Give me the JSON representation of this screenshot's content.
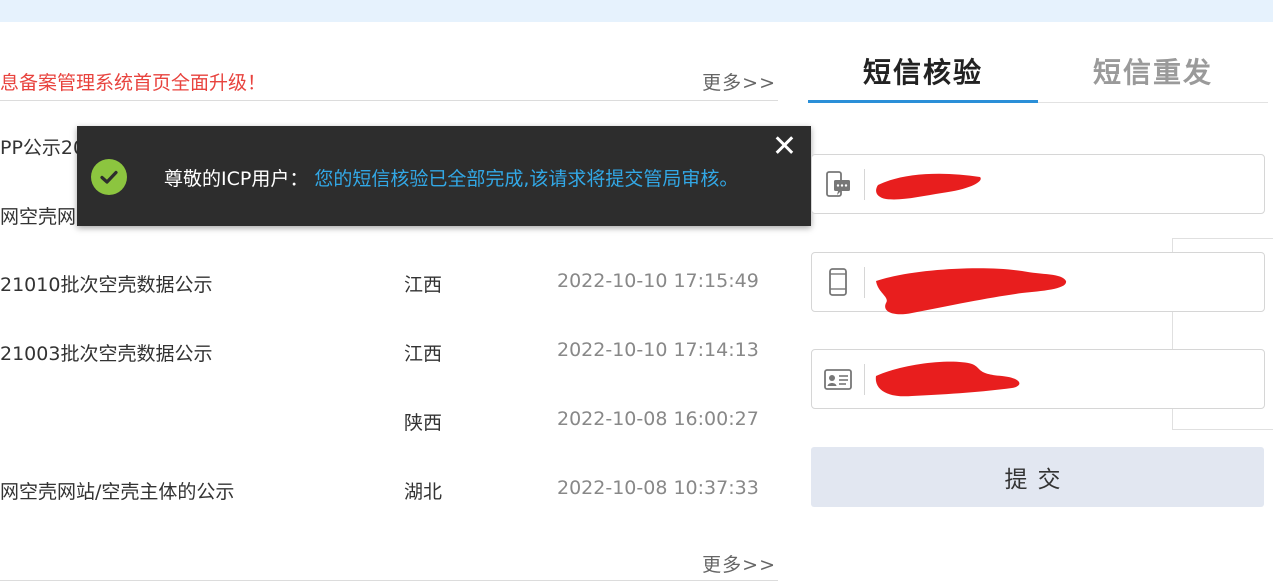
{
  "news": {
    "headline": "息备案管理系统首页全面升级！",
    "more_label": "更多>>",
    "rows": [
      {
        "title": "PP公示20",
        "province": "",
        "date": ""
      },
      {
        "title": "网空壳网",
        "province": "",
        "date": ""
      },
      {
        "title": "21010批次空壳数据公示",
        "province": "江西",
        "date": "2022-10-10 17:15:49"
      },
      {
        "title": "21003批次空壳数据公示",
        "province": "江西",
        "date": "2022-10-10 17:14:13"
      },
      {
        "title": "",
        "province": "陕西",
        "date": "2022-10-08 16:00:27"
      },
      {
        "title": "网空壳网站/空壳主体的公示",
        "province": "湖北",
        "date": "2022-10-08 10:37:33"
      }
    ],
    "more_bottom_label": "更多>>"
  },
  "toast": {
    "label": "尊敬的ICP用户：",
    "message": "您的短信核验已全部完成,该请求将提交管局审核。",
    "close": "✕",
    "success_color": "#8cc53f",
    "message_color": "#32a8e6"
  },
  "sms": {
    "tabs": [
      {
        "label": "短信核验",
        "active": true
      },
      {
        "label": "短信重发",
        "active": false
      }
    ],
    "fields": [
      {
        "icon": "sms-code-icon",
        "value": ""
      },
      {
        "icon": "phone-icon",
        "value": ""
      },
      {
        "icon": "id-card-icon",
        "value": ""
      }
    ],
    "submit_label": "提交",
    "accent_color": "#2a8fd8",
    "redaction_color": "#e81e1e"
  }
}
